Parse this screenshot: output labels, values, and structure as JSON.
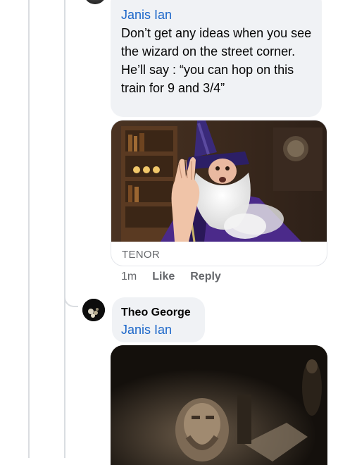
{
  "comment_1": {
    "mention": "Janis Ian",
    "text": "Don’t get any ideas when you see the wizard on the street corner.\nHe’ll say : “you can hop on this train for 9 and 3/4”",
    "gif": {
      "subject": "wizard-gif",
      "source_label": "TENOR"
    },
    "actions": {
      "time": "1m",
      "like_label": "Like",
      "reply_label": "Reply"
    }
  },
  "comment_2": {
    "author": "Theo George",
    "mention": "Janis Ian",
    "gif": {
      "subject": "old-man-gif"
    }
  },
  "colors": {
    "bubble_bg": "#f0f2f5",
    "mention_blue": "#1b66c9",
    "meta_gray": "#65676b",
    "thread_line": "#dadde1"
  }
}
